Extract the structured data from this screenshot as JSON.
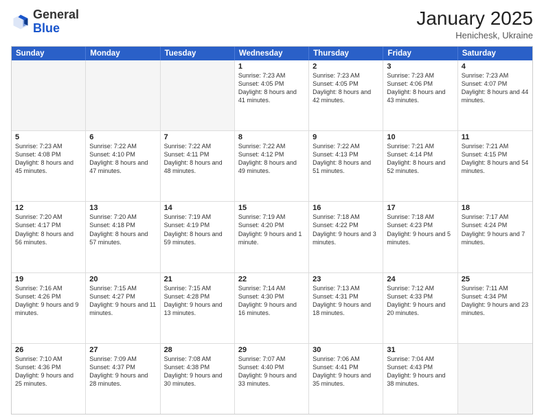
{
  "header": {
    "logo_general": "General",
    "logo_blue": "Blue",
    "month_year": "January 2025",
    "location": "Henichesk, Ukraine"
  },
  "weekdays": [
    "Sunday",
    "Monday",
    "Tuesday",
    "Wednesday",
    "Thursday",
    "Friday",
    "Saturday"
  ],
  "rows": [
    [
      {
        "day": "",
        "text": "",
        "empty": true
      },
      {
        "day": "",
        "text": "",
        "empty": true
      },
      {
        "day": "",
        "text": "",
        "empty": true
      },
      {
        "day": "1",
        "text": "Sunrise: 7:23 AM\nSunset: 4:05 PM\nDaylight: 8 hours and 41 minutes."
      },
      {
        "day": "2",
        "text": "Sunrise: 7:23 AM\nSunset: 4:05 PM\nDaylight: 8 hours and 42 minutes."
      },
      {
        "day": "3",
        "text": "Sunrise: 7:23 AM\nSunset: 4:06 PM\nDaylight: 8 hours and 43 minutes."
      },
      {
        "day": "4",
        "text": "Sunrise: 7:23 AM\nSunset: 4:07 PM\nDaylight: 8 hours and 44 minutes."
      }
    ],
    [
      {
        "day": "5",
        "text": "Sunrise: 7:23 AM\nSunset: 4:08 PM\nDaylight: 8 hours and 45 minutes."
      },
      {
        "day": "6",
        "text": "Sunrise: 7:22 AM\nSunset: 4:10 PM\nDaylight: 8 hours and 47 minutes."
      },
      {
        "day": "7",
        "text": "Sunrise: 7:22 AM\nSunset: 4:11 PM\nDaylight: 8 hours and 48 minutes."
      },
      {
        "day": "8",
        "text": "Sunrise: 7:22 AM\nSunset: 4:12 PM\nDaylight: 8 hours and 49 minutes."
      },
      {
        "day": "9",
        "text": "Sunrise: 7:22 AM\nSunset: 4:13 PM\nDaylight: 8 hours and 51 minutes."
      },
      {
        "day": "10",
        "text": "Sunrise: 7:21 AM\nSunset: 4:14 PM\nDaylight: 8 hours and 52 minutes."
      },
      {
        "day": "11",
        "text": "Sunrise: 7:21 AM\nSunset: 4:15 PM\nDaylight: 8 hours and 54 minutes."
      }
    ],
    [
      {
        "day": "12",
        "text": "Sunrise: 7:20 AM\nSunset: 4:17 PM\nDaylight: 8 hours and 56 minutes."
      },
      {
        "day": "13",
        "text": "Sunrise: 7:20 AM\nSunset: 4:18 PM\nDaylight: 8 hours and 57 minutes."
      },
      {
        "day": "14",
        "text": "Sunrise: 7:19 AM\nSunset: 4:19 PM\nDaylight: 8 hours and 59 minutes."
      },
      {
        "day": "15",
        "text": "Sunrise: 7:19 AM\nSunset: 4:20 PM\nDaylight: 9 hours and 1 minute."
      },
      {
        "day": "16",
        "text": "Sunrise: 7:18 AM\nSunset: 4:22 PM\nDaylight: 9 hours and 3 minutes."
      },
      {
        "day": "17",
        "text": "Sunrise: 7:18 AM\nSunset: 4:23 PM\nDaylight: 9 hours and 5 minutes."
      },
      {
        "day": "18",
        "text": "Sunrise: 7:17 AM\nSunset: 4:24 PM\nDaylight: 9 hours and 7 minutes."
      }
    ],
    [
      {
        "day": "19",
        "text": "Sunrise: 7:16 AM\nSunset: 4:26 PM\nDaylight: 9 hours and 9 minutes."
      },
      {
        "day": "20",
        "text": "Sunrise: 7:15 AM\nSunset: 4:27 PM\nDaylight: 9 hours and 11 minutes."
      },
      {
        "day": "21",
        "text": "Sunrise: 7:15 AM\nSunset: 4:28 PM\nDaylight: 9 hours and 13 minutes."
      },
      {
        "day": "22",
        "text": "Sunrise: 7:14 AM\nSunset: 4:30 PM\nDaylight: 9 hours and 16 minutes."
      },
      {
        "day": "23",
        "text": "Sunrise: 7:13 AM\nSunset: 4:31 PM\nDaylight: 9 hours and 18 minutes."
      },
      {
        "day": "24",
        "text": "Sunrise: 7:12 AM\nSunset: 4:33 PM\nDaylight: 9 hours and 20 minutes."
      },
      {
        "day": "25",
        "text": "Sunrise: 7:11 AM\nSunset: 4:34 PM\nDaylight: 9 hours and 23 minutes."
      }
    ],
    [
      {
        "day": "26",
        "text": "Sunrise: 7:10 AM\nSunset: 4:36 PM\nDaylight: 9 hours and 25 minutes."
      },
      {
        "day": "27",
        "text": "Sunrise: 7:09 AM\nSunset: 4:37 PM\nDaylight: 9 hours and 28 minutes."
      },
      {
        "day": "28",
        "text": "Sunrise: 7:08 AM\nSunset: 4:38 PM\nDaylight: 9 hours and 30 minutes."
      },
      {
        "day": "29",
        "text": "Sunrise: 7:07 AM\nSunset: 4:40 PM\nDaylight: 9 hours and 33 minutes."
      },
      {
        "day": "30",
        "text": "Sunrise: 7:06 AM\nSunset: 4:41 PM\nDaylight: 9 hours and 35 minutes."
      },
      {
        "day": "31",
        "text": "Sunrise: 7:04 AM\nSunset: 4:43 PM\nDaylight: 9 hours and 38 minutes."
      },
      {
        "day": "",
        "text": "",
        "empty": true,
        "gray": true
      }
    ]
  ]
}
